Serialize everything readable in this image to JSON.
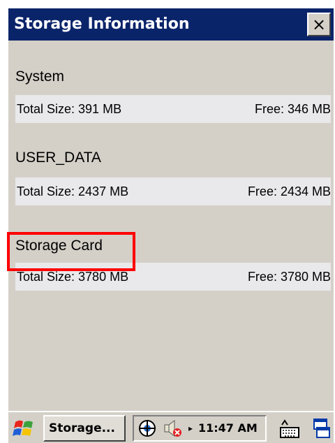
{
  "window": {
    "title": "Storage Information",
    "close_label": "×"
  },
  "sections": [
    {
      "name": "System",
      "total": "Total Size: 391 MB",
      "free": "Free: 346 MB"
    },
    {
      "name": "USER_DATA",
      "total": "Total Size: 2437 MB",
      "free": "Free: 2434 MB"
    },
    {
      "name": "Storage Card",
      "total": "Total Size: 3780 MB",
      "free": "Free: 3780 MB"
    }
  ],
  "taskbar": {
    "app_button_label": "Storage...",
    "clock": "11:47 AM",
    "tray_arrow": "▸"
  },
  "colors": {
    "title_bar": "#0a246a",
    "window_bg": "#d4d0c8",
    "row_bg": "#e9e8ea",
    "highlight": "#ff0000"
  },
  "icons": [
    "windows-start-icon",
    "network-icon",
    "volume-muted-icon",
    "keyboard-icon",
    "desktop-icon"
  ]
}
